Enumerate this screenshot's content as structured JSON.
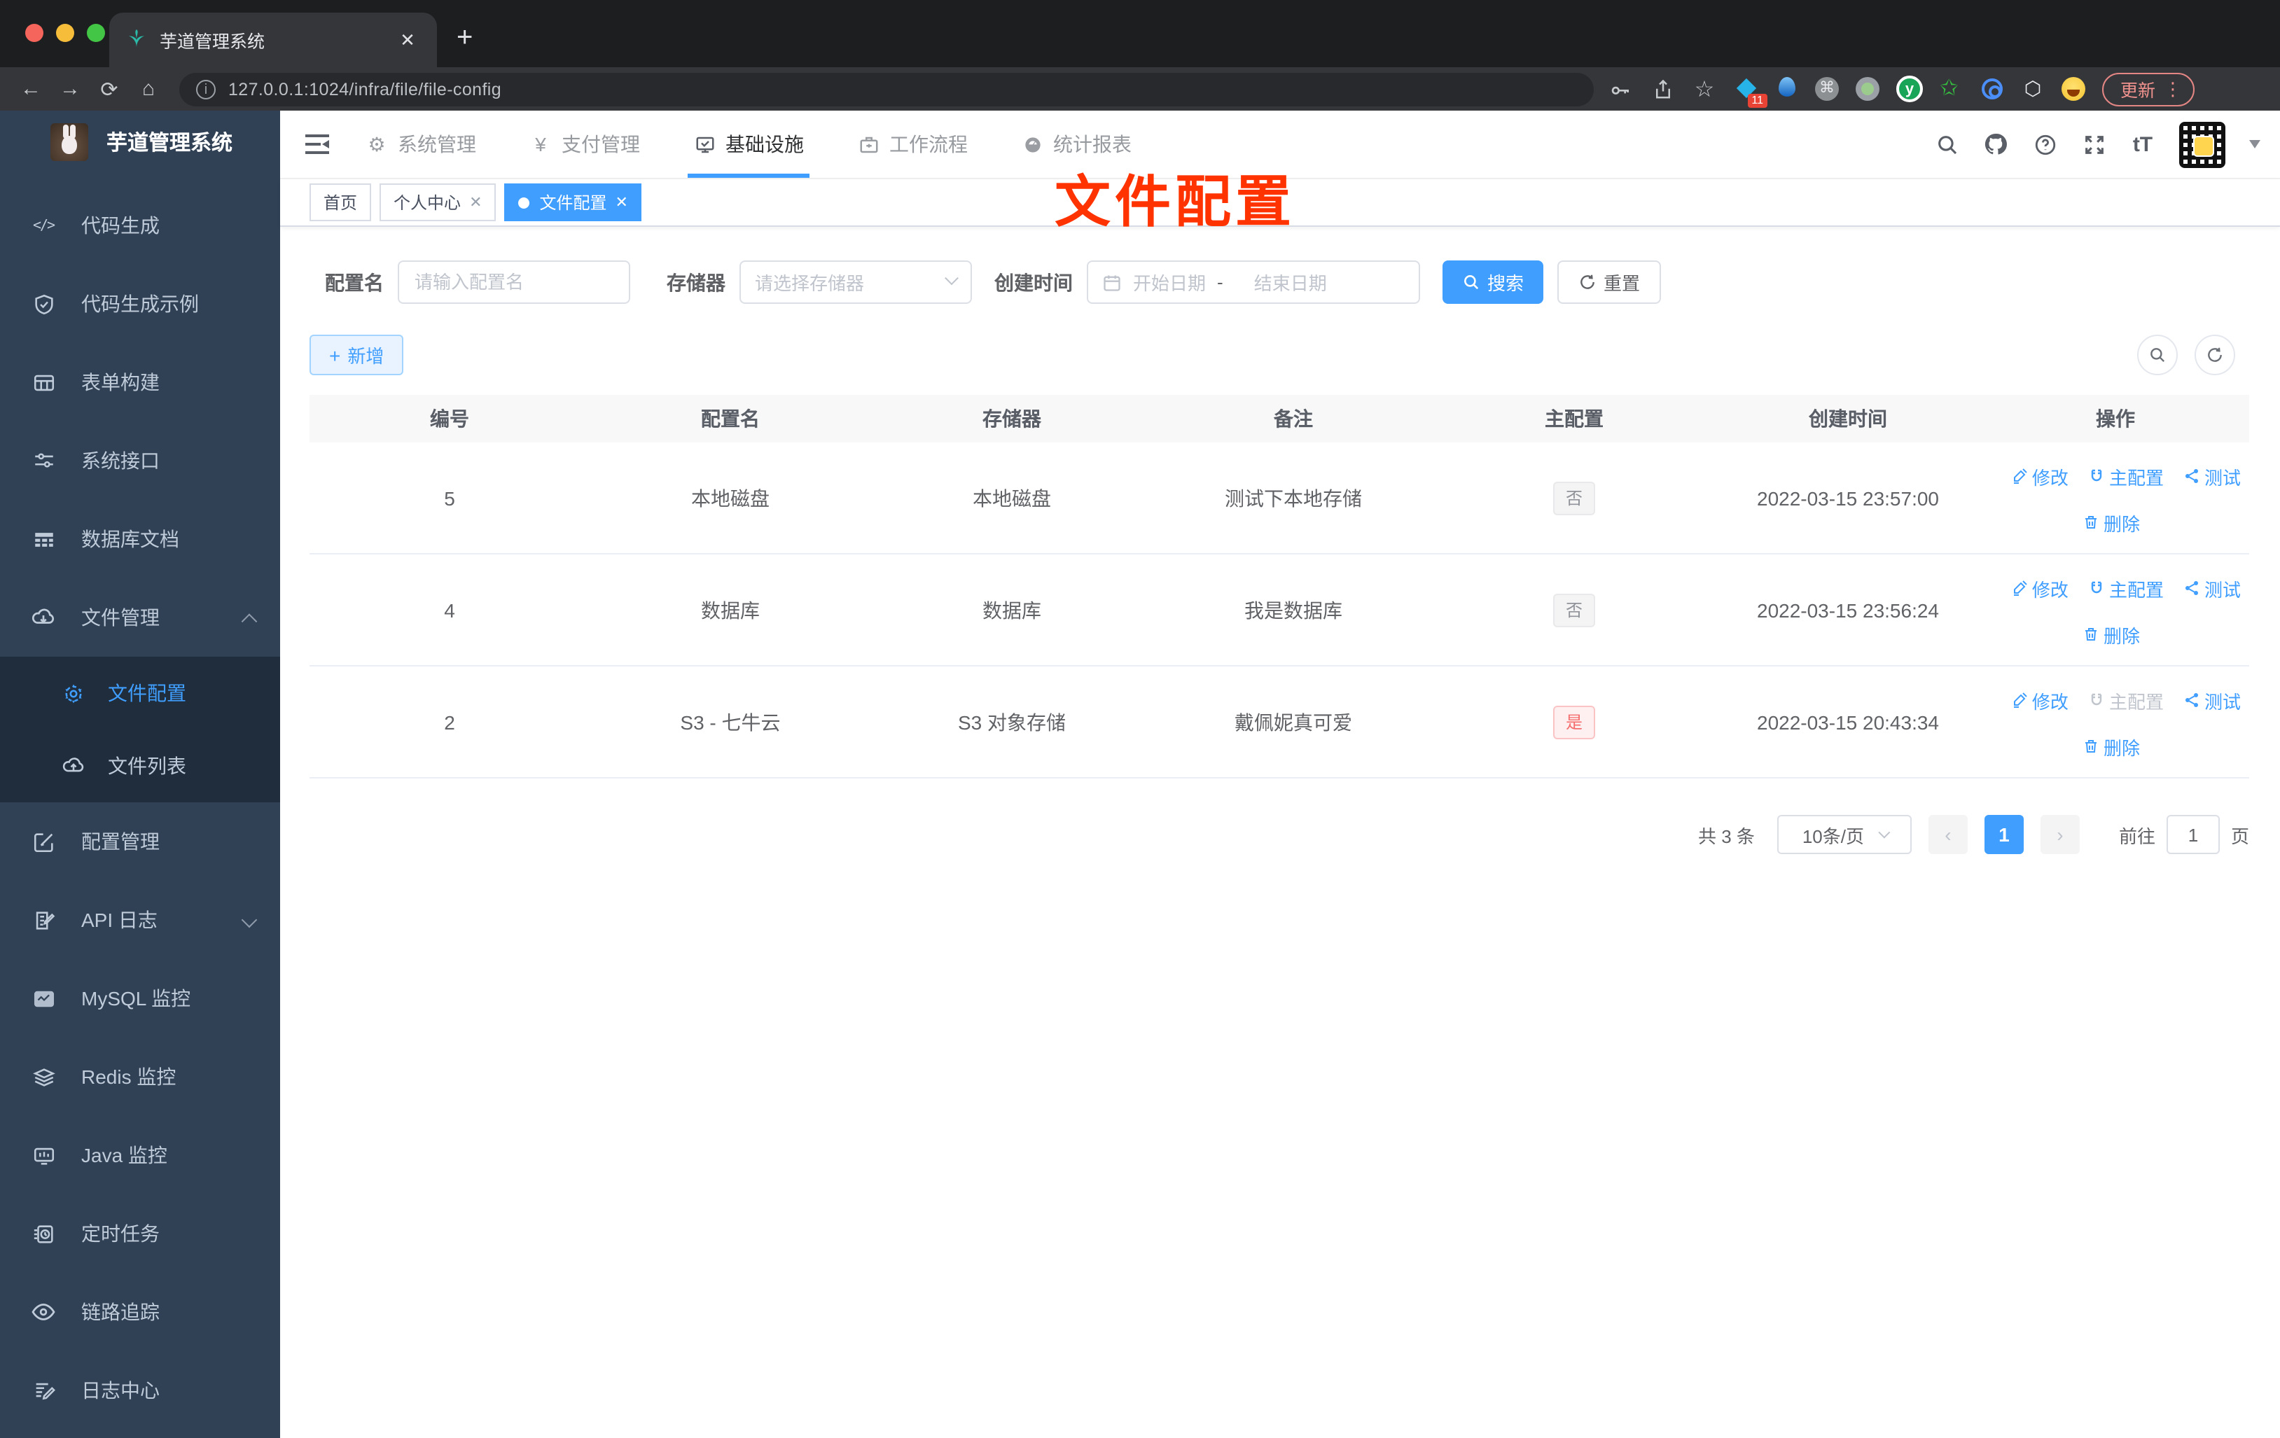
{
  "colors": {
    "accent": "#409eff",
    "sidebar_bg": "#304156",
    "submenu_bg": "#1f2d3d",
    "danger": "#f56c6c",
    "annotation": "#ff3300"
  },
  "browser": {
    "tab_title": "芋道管理系统",
    "url": "127.0.0.1:1024/infra/file/file-config",
    "extension_badge": "11",
    "update_label": "更新"
  },
  "sidebar": {
    "title": "芋道管理系统",
    "items": [
      "代码生成",
      "代码生成示例",
      "表单构建",
      "系统接口",
      "数据库文档",
      "文件管理",
      "文件配置",
      "文件列表",
      "配置管理",
      "API 日志",
      "MySQL 监控",
      "Redis 监控",
      "Java 监控",
      "定时任务",
      "链路追踪",
      "日志中心"
    ]
  },
  "header": {
    "menus": [
      "系统管理",
      "支付管理",
      "基础设施",
      "工作流程",
      "统计报表"
    ],
    "font_size_icon": "tT"
  },
  "tags": {
    "items": [
      "首页",
      "个人中心",
      "文件配置"
    ]
  },
  "annotation": "文件配置",
  "filters": {
    "name_label": "配置名",
    "name_placeholder": "请输入配置名",
    "storage_label": "存储器",
    "storage_placeholder": "请选择存储器",
    "date_label": "创建时间",
    "date_start": "开始日期",
    "date_sep": "-",
    "date_end": "结束日期",
    "search_label": "搜索",
    "reset_label": "重置",
    "add_label": "新增"
  },
  "table": {
    "headers": [
      "编号",
      "配置名",
      "存储器",
      "备注",
      "主配置",
      "创建时间",
      "操作"
    ],
    "actions": {
      "modify": "修改",
      "master": "主配置",
      "test": "测试",
      "remove": "删除"
    },
    "rows": [
      {
        "id": "5",
        "name": "本地磁盘",
        "storage": "本地磁盘",
        "remark": "测试下本地存储",
        "master": "否",
        "created": "2022-03-15 23:57:00"
      },
      {
        "id": "4",
        "name": "数据库",
        "storage": "数据库",
        "remark": "我是数据库",
        "master": "否",
        "created": "2022-03-15 23:56:24"
      },
      {
        "id": "2",
        "name": "S3 - 七牛云",
        "storage": "S3 对象存储",
        "remark": "戴佩妮真可爱",
        "master": "是",
        "created": "2022-03-15 20:43:34"
      }
    ]
  },
  "pagination": {
    "total": "共 3 条",
    "page_size": "10条/页",
    "current_page": "1",
    "goto_label": "前往",
    "goto_value": "1",
    "page_suffix": "页"
  }
}
